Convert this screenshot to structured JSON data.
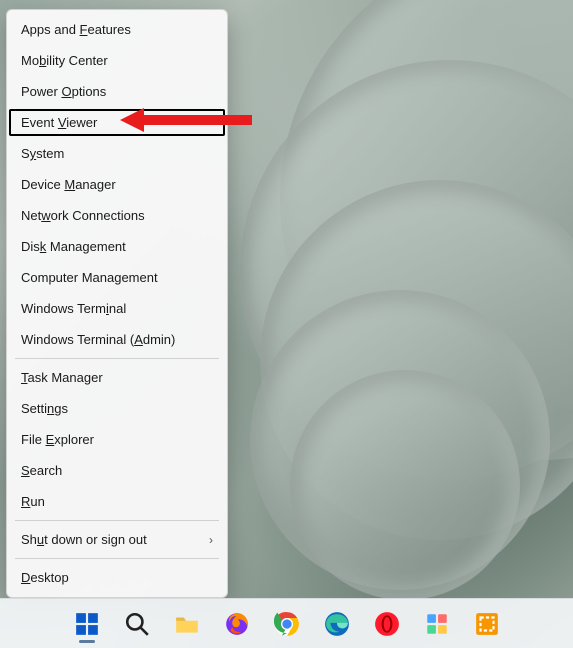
{
  "menu": {
    "items": [
      {
        "pre": "Apps and ",
        "u": "F",
        "post": "eatures"
      },
      {
        "pre": "Mo",
        "u": "b",
        "post": "ility Center"
      },
      {
        "pre": "Power ",
        "u": "O",
        "post": "ptions"
      },
      {
        "pre": "Event ",
        "u": "V",
        "post": "iewer",
        "highlight": true
      },
      {
        "pre": "S",
        "u": "y",
        "post": "stem"
      },
      {
        "pre": "Device ",
        "u": "M",
        "post": "anager"
      },
      {
        "pre": "Net",
        "u": "w",
        "post": "ork Connections"
      },
      {
        "pre": "Dis",
        "u": "k",
        "post": " Management"
      },
      {
        "pre": "Computer Mana",
        "u": "g",
        "post": "ement"
      },
      {
        "pre": "Windows Term",
        "u": "i",
        "post": "nal"
      },
      {
        "pre": "Windows Terminal (",
        "u": "A",
        "post": "dmin)"
      },
      {
        "sep": true
      },
      {
        "pre": "",
        "u": "T",
        "post": "ask Manager"
      },
      {
        "pre": "Setti",
        "u": "n",
        "post": "gs"
      },
      {
        "pre": "File ",
        "u": "E",
        "post": "xplorer"
      },
      {
        "pre": "",
        "u": "S",
        "post": "earch"
      },
      {
        "pre": "",
        "u": "R",
        "post": "un"
      },
      {
        "sep": true
      },
      {
        "pre": "Sh",
        "u": "u",
        "post": "t down or sign out",
        "submenu": true
      },
      {
        "sep": true
      },
      {
        "pre": "",
        "u": "D",
        "post": "esktop"
      }
    ]
  },
  "taskbar": {
    "items": [
      {
        "name": "start-button",
        "icon": "windows"
      },
      {
        "name": "search-button",
        "icon": "search"
      },
      {
        "name": "file-explorer",
        "icon": "folder"
      },
      {
        "name": "firefox",
        "icon": "firefox"
      },
      {
        "name": "chrome",
        "icon": "chrome"
      },
      {
        "name": "edge",
        "icon": "edge"
      },
      {
        "name": "opera",
        "icon": "opera"
      },
      {
        "name": "app-generic",
        "icon": "grid"
      },
      {
        "name": "vmware",
        "icon": "vmware"
      }
    ]
  },
  "callout": {
    "color": "#e81c1c"
  }
}
